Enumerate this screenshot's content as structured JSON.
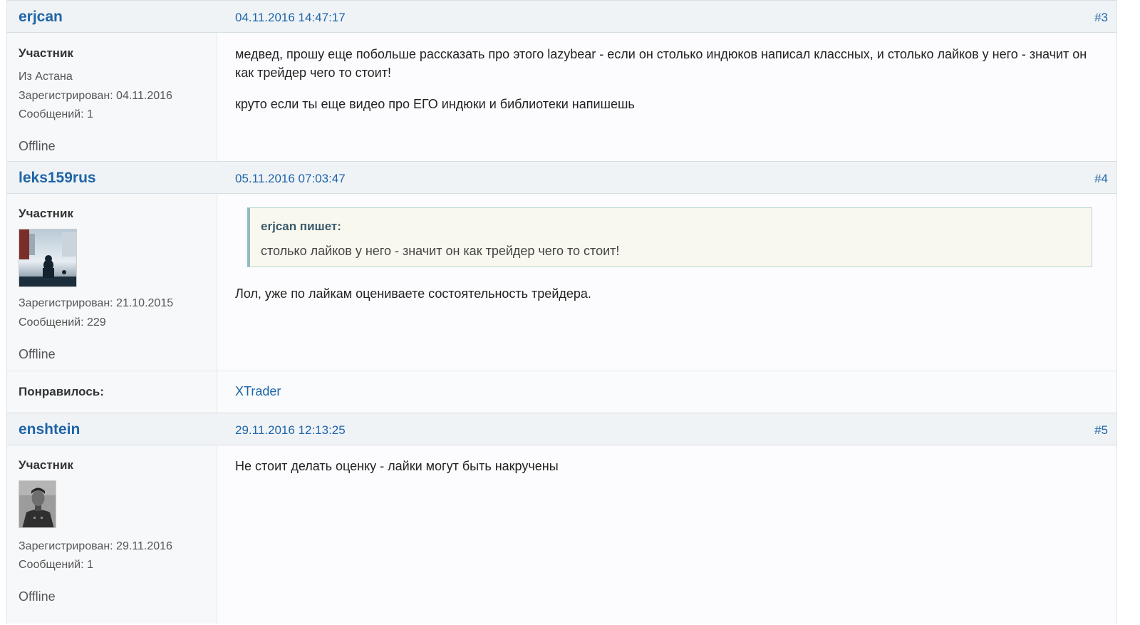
{
  "posts": [
    {
      "author": "erjcan",
      "date": "04.11.2016 14:47:17",
      "number": "#3",
      "rank": "Участник",
      "location": "Из Астана",
      "registered": "Зарегистрирован: 04.11.2016",
      "messages": "Сообщений: 1",
      "status": "Offline",
      "body": [
        "медвед, прошу еще побольше рассказать про этого lazybear - если он столько индюков написал классных, и столько лайков у него - значит он как трейдер чего то стоит!",
        "круто если ты еще видео про ЕГО индюки и библиотеки напишешь"
      ]
    },
    {
      "author": "leks159rus",
      "date": "05.11.2016 07:03:47",
      "number": "#4",
      "rank": "Участник",
      "registered": "Зарегистрирован: 21.10.2015",
      "messages": "Сообщений: 229",
      "status": "Offline",
      "quote": {
        "author": "erjcan пишет:",
        "text": "столько лайков у него - значит он как трейдер чего то стоит!"
      },
      "body": [
        "Лол, уже по лайкам оцениваете состоятельность трейдера."
      ],
      "likes_label": "Понравилось:",
      "likes_user": "XTrader"
    },
    {
      "author": "enshtein",
      "date": "29.11.2016 12:13:25",
      "number": "#5",
      "rank": "Участник",
      "registered": "Зарегистрирован: 29.11.2016",
      "messages": "Сообщений: 1",
      "status": "Offline",
      "body": [
        "Не стоит делать оценку - лайки могут быть накручены"
      ]
    }
  ]
}
